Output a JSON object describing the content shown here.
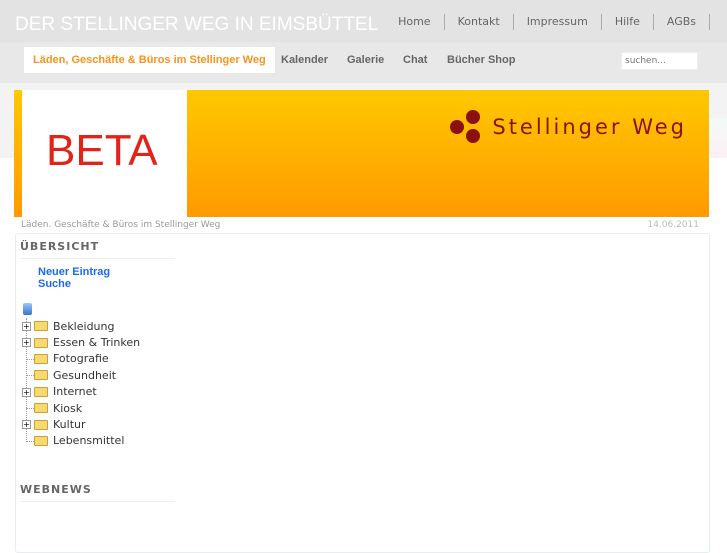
{
  "site_title": "DER STELLINGER WEG IN EIMSBÜTTEL",
  "top_links": [
    "Home",
    "Kontakt",
    "Impressum",
    "Hilfe",
    "AGBs"
  ],
  "nav": {
    "items": [
      "Läden, Geschäfte & Büros im Stellinger Weg",
      "Kalender",
      "Galerie",
      "Chat",
      "Bücher Shop"
    ],
    "search_placeholder": "suchen..."
  },
  "banner": {
    "beta": "BETA",
    "logo_text": "Stellinger Weg"
  },
  "breadcrumb": "Läden. Geschäfte & Büros im Stellinger Weg",
  "date": "14.06.2011",
  "sidebar": {
    "overview_heading": "ÜBERSICHT",
    "links": [
      "Neuer Eintrag",
      "Suche"
    ],
    "tree": [
      {
        "label": "Bekleidung",
        "expandable": true
      },
      {
        "label": "Essen & Trinken",
        "expandable": true
      },
      {
        "label": "Fotografie",
        "expandable": false
      },
      {
        "label": "Gesundheit",
        "expandable": false
      },
      {
        "label": "Internet",
        "expandable": true
      },
      {
        "label": "Kiosk",
        "expandable": false
      },
      {
        "label": "Kultur",
        "expandable": true
      },
      {
        "label": "Lebensmittel",
        "expandable": false
      }
    ],
    "webnews_heading": "WEBNEWS"
  },
  "colors": {
    "accent": "#f7931e",
    "link": "#1a6bef",
    "logo": "#8b1010",
    "beta": "#e2231a"
  }
}
